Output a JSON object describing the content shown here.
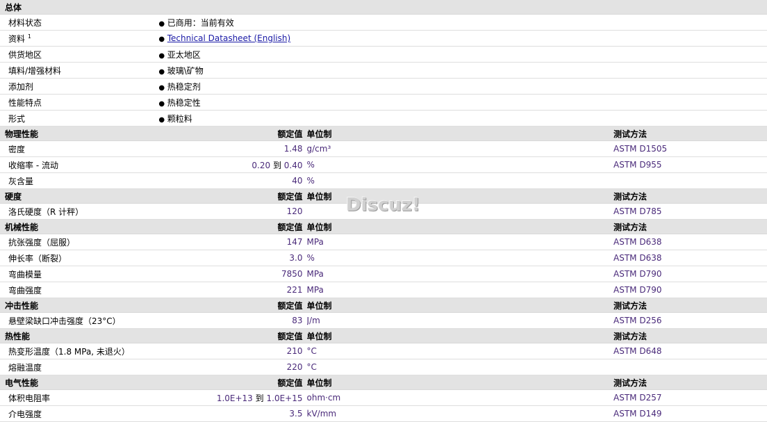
{
  "general": {
    "section_title": "总体",
    "rows": [
      {
        "label": "材料状态",
        "sup": "",
        "value": "已商用：当前有效",
        "link": false
      },
      {
        "label": "资料",
        "sup": "1",
        "value": "Technical Datasheet (English)",
        "link": true
      },
      {
        "label": "供货地区",
        "sup": "",
        "value": "亚太地区",
        "link": false
      },
      {
        "label": "填料/增强材料",
        "sup": "",
        "value": "玻璃\\矿物",
        "link": false
      },
      {
        "label": "添加剂",
        "sup": "",
        "value": "热稳定剂",
        "link": false
      },
      {
        "label": "性能特点",
        "sup": "",
        "value": "热稳定性",
        "link": false
      },
      {
        "label": "形式",
        "sup": "",
        "value": "颗粒料",
        "link": false
      }
    ]
  },
  "column_headers": {
    "nominal": "额定值",
    "unit": "单位制",
    "method": "测试方法"
  },
  "range_word": "到",
  "sections": [
    {
      "title": "物理性能",
      "rows": [
        {
          "label": "密度",
          "value": "1.48",
          "unit": "g/cm³",
          "method": "ASTM D1505"
        },
        {
          "label": "收缩率 - 流动",
          "value_from": "0.20",
          "value_to": "0.40",
          "unit": "%",
          "method": "ASTM D955"
        },
        {
          "label": "灰含量",
          "value": "40",
          "unit": "%",
          "method": ""
        }
      ]
    },
    {
      "title": "硬度",
      "rows": [
        {
          "label": "洛氏硬度（R 计秤）",
          "value": "120",
          "unit": "",
          "method": "ASTM D785"
        }
      ]
    },
    {
      "title": "机械性能",
      "rows": [
        {
          "label": "抗张强度（屈服）",
          "value": "147",
          "unit": "MPa",
          "method": "ASTM D638"
        },
        {
          "label": "伸长率（断裂）",
          "value": "3.0",
          "unit": "%",
          "method": "ASTM D638"
        },
        {
          "label": "弯曲模量",
          "value": "7850",
          "unit": "MPa",
          "method": "ASTM D790"
        },
        {
          "label": "弯曲强度",
          "value": "221",
          "unit": "MPa",
          "method": "ASTM D790"
        }
      ]
    },
    {
      "title": "冲击性能",
      "rows": [
        {
          "label": "悬壁梁缺口冲击强度（23°C）",
          "value": "83",
          "unit": "J/m",
          "method": "ASTM D256"
        }
      ]
    },
    {
      "title": "热性能",
      "rows": [
        {
          "label": "热变形温度（1.8 MPa, 未退火）",
          "value": "210",
          "unit": "°C",
          "method": "ASTM D648"
        },
        {
          "label": "熔融温度",
          "value": "220",
          "unit": "°C",
          "method": ""
        }
      ]
    },
    {
      "title": "电气性能",
      "rows": [
        {
          "label": "体积电阻率",
          "value_from": "1.0E+13",
          "value_to": "1.0E+15",
          "unit": "ohm·cm",
          "method": "ASTM D257"
        },
        {
          "label": "介电强度",
          "value": "3.5",
          "unit": "kV/mm",
          "method": "ASTM D149"
        }
      ]
    }
  ],
  "watermark": "Discuz!"
}
